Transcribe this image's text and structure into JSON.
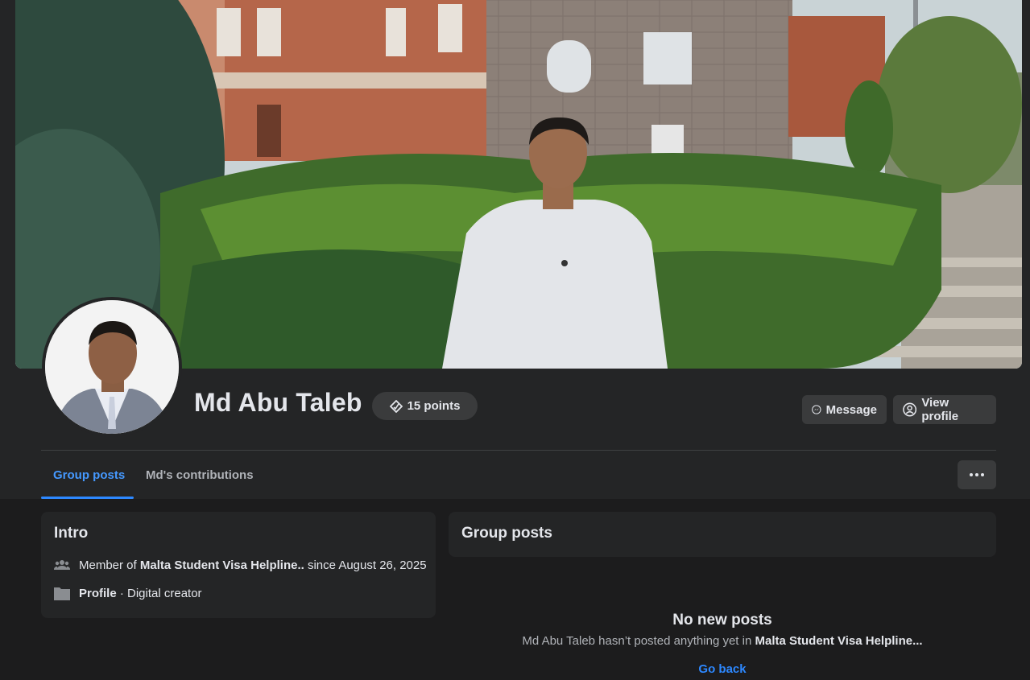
{
  "profile": {
    "name": "Md Abu Taleb",
    "points": "15 points"
  },
  "actions": {
    "message_label": "Message",
    "view_profile_label": "View profile"
  },
  "tabs": [
    {
      "label": "Group posts",
      "active": true
    },
    {
      "label": "Md's contributions",
      "active": false
    }
  ],
  "intro": {
    "title": "Intro",
    "membership_prefix": "Member of ",
    "group_name": "Malta Student Visa Helpline..",
    "membership_suffix": " since August 26, 2025",
    "profile_label": "Profile",
    "profile_suffix": " · Digital creator"
  },
  "group_posts": {
    "title": "Group posts",
    "empty_title": "No new posts",
    "empty_prefix": "Md Abu Taleb hasn’t posted anything yet in ",
    "empty_group": "Malta Student Visa Helpline...",
    "go_back": "Go back"
  },
  "colors": {
    "accent": "#2d88ff",
    "background": "#1c1c1d",
    "card": "#242526",
    "button": "#3a3b3c"
  }
}
